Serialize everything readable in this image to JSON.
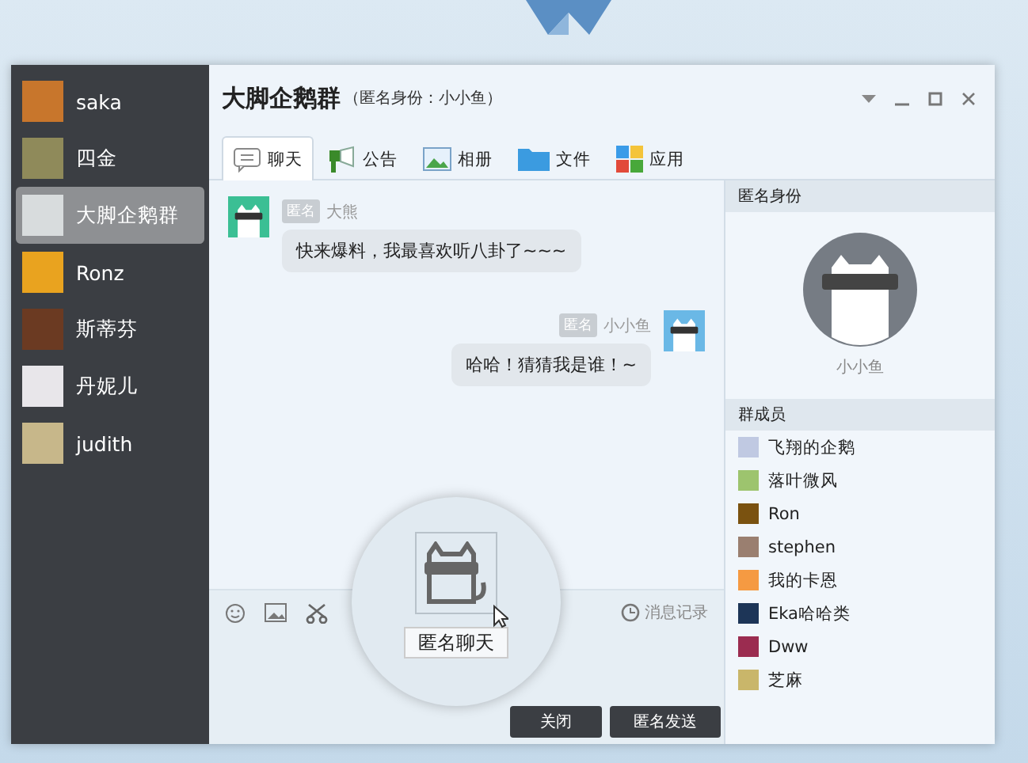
{
  "sidebar": {
    "items": [
      {
        "name": "saka",
        "selected": false
      },
      {
        "name": "四金",
        "selected": false
      },
      {
        "name": "大脚企鹅群",
        "selected": true
      },
      {
        "name": "Ronz",
        "selected": false
      },
      {
        "name": "斯蒂芬",
        "selected": false
      },
      {
        "name": "丹妮儿",
        "selected": false
      },
      {
        "name": "judith",
        "selected": false
      }
    ]
  },
  "chat": {
    "title": "大脚企鹅群",
    "subtitle": "（匿名身份：小小鱼）",
    "tabs": [
      {
        "label": "聊天",
        "kind": "chat",
        "selected": true
      },
      {
        "label": "公告",
        "kind": "notice",
        "selected": false
      },
      {
        "label": "相册",
        "kind": "album",
        "selected": false
      },
      {
        "label": "文件",
        "kind": "file",
        "selected": false
      },
      {
        "label": "应用",
        "kind": "apps",
        "selected": false
      }
    ],
    "messages": [
      {
        "kind": "incoming",
        "badge": "匿名",
        "sender": "大熊",
        "text": "快来爆料，我最喜欢听八卦了~~~"
      },
      {
        "kind": "outgoing",
        "badge": "匿名",
        "sender": "小小鱼",
        "text": "哈哈！猜猜我是谁！~"
      }
    ],
    "history": "消息记录",
    "buttons": {
      "close": "关闭",
      "send": "匿名发送"
    }
  },
  "popup": {
    "button": "匿名聊天"
  },
  "identity": {
    "title": "匿名身份",
    "name": "小小鱼"
  },
  "members": {
    "title": "群成员",
    "items": [
      {
        "name": "飞翔的企鹅",
        "color": "#c0c9e2"
      },
      {
        "name": "落叶微风",
        "color": "#9dc46e"
      },
      {
        "name": "Ron",
        "color": "#7a5210"
      },
      {
        "name": "stephen",
        "color": "#9a7f70"
      },
      {
        "name": "我的卡恩",
        "color": "#f59a42"
      },
      {
        "name": "Eka哈哈类",
        "color": "#1d3557"
      },
      {
        "name": "Dww",
        "color": "#9b2c50"
      },
      {
        "name": "芝麻",
        "color": "#c9b66a"
      }
    ]
  }
}
